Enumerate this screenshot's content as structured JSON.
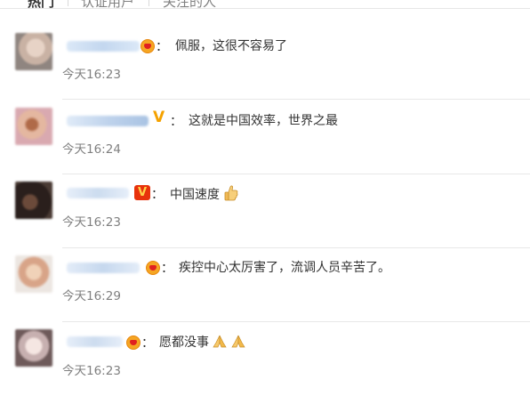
{
  "tabs": [
    {
      "label": "热门",
      "active": true
    },
    {
      "label": "认证用户",
      "active": false
    },
    {
      "label": "关注的人",
      "active": false
    }
  ],
  "comments": [
    {
      "badge": "crown-icon",
      "text": "佩服，这很不容易了",
      "time": "今天16:23"
    },
    {
      "badge": "v-gold-icon",
      "text": "这就是中国效率，世界之最",
      "time": "今天16:24"
    },
    {
      "badge": "v-red-icon",
      "text": "中国速度",
      "emoji": "thumbs-up-icon",
      "time": "今天16:23"
    },
    {
      "badge": "crown-icon",
      "text": "疾控中心太厉害了，流调人员辛苦了。",
      "time": "今天16:29"
    },
    {
      "badge": "crown-icon",
      "text": "愿都没事",
      "emoji": "praying-hands-icon",
      "time": "今天16:23"
    }
  ],
  "colon": "：",
  "badge_letters": {
    "v": "V"
  },
  "colors": {
    "text": "#333333",
    "time": "#808080",
    "crown": "#f5a623",
    "v_gold": "#f5a200",
    "v_red": "#e8320b"
  }
}
